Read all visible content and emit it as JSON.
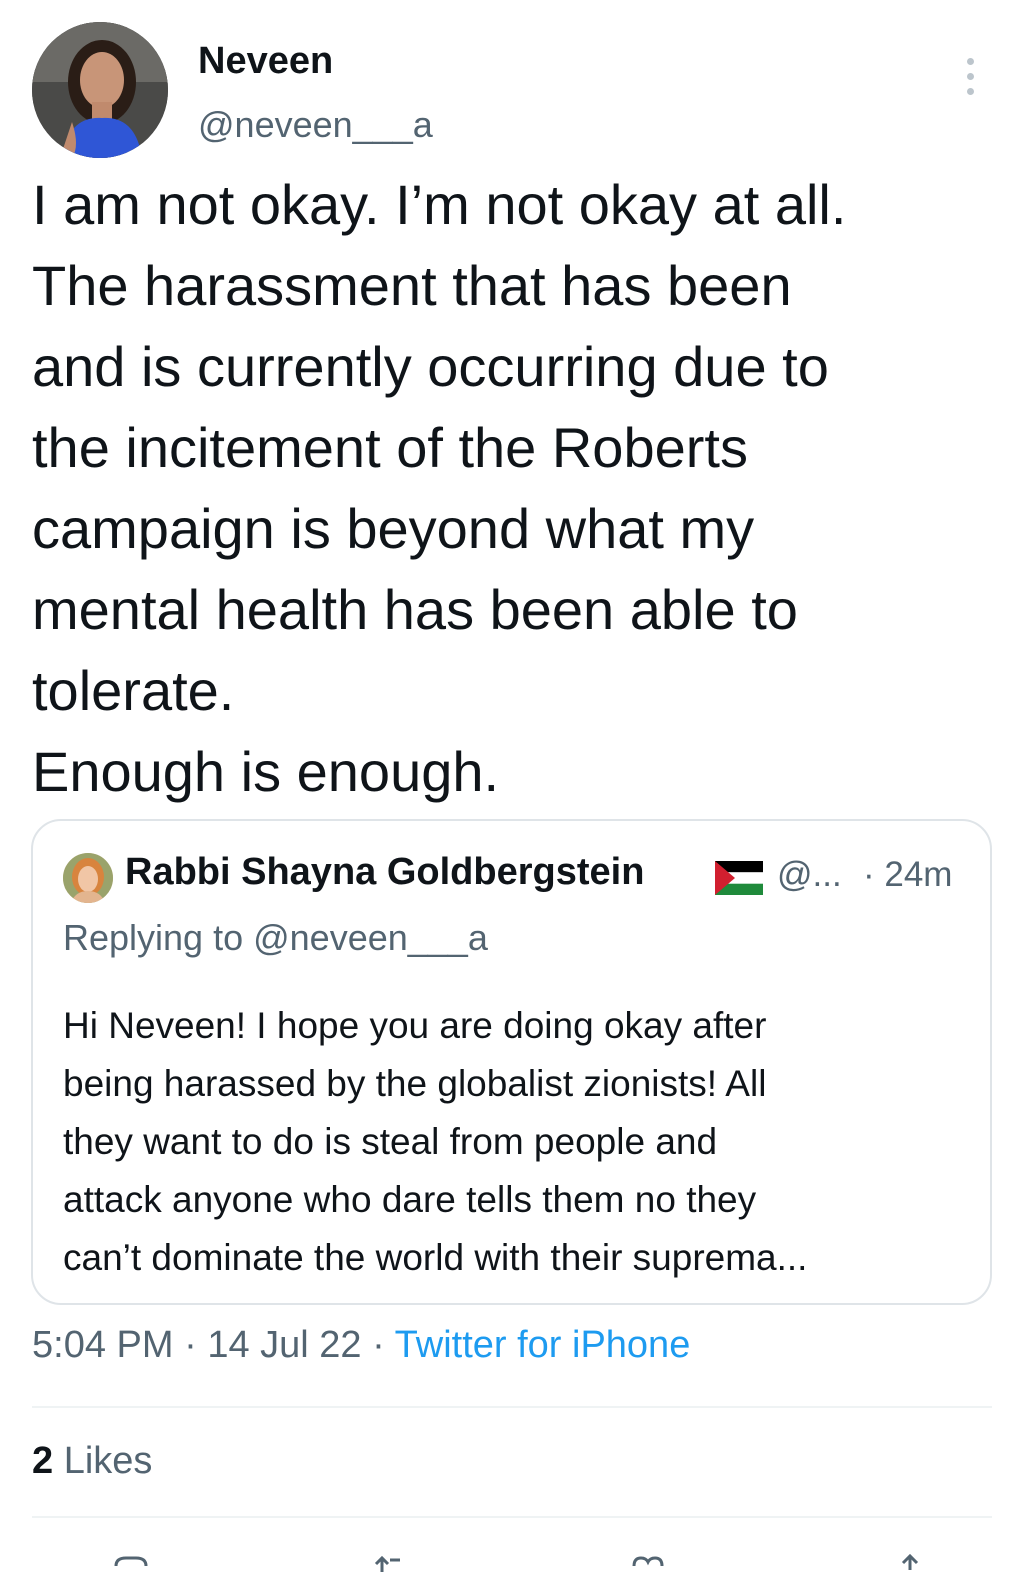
{
  "tweet": {
    "author_name": "Neveen",
    "author_handle": "@neveen___a",
    "text": "I am not okay. I’m not okay at all.\nThe harassment that has been\nand is currently occurring due to\nthe incitement of the Roberts\ncampaign is beyond what my\nmental health has been able to\ntolerate.\nEnough is enough.",
    "time": "5:04 PM",
    "date": "14 Jul 22",
    "separator": "·",
    "source": "Twitter for iPhone",
    "likes_count": "2",
    "likes_label": "Likes"
  },
  "quote": {
    "author_name": "Rabbi Shayna Goldbergstein",
    "handle": "@...",
    "time_ago": "· 24m",
    "replying_label": "Replying to @neveen___a",
    "text": "Hi Neveen! I hope you are doing okay after\nbeing harassed by the globalist zionists! All\nthey want to do is steal from people and\nattack anyone who dare tells them no they\ncan’t dominate the world with their suprema..."
  },
  "icons": [
    "more-vertical-icon",
    "palestine-flag-icon",
    "reply-icon",
    "retweet-icon",
    "like-icon",
    "share-icon"
  ],
  "colors": {
    "text_primary": "#0f1419",
    "text_secondary": "#536471",
    "link": "#1d9bf0",
    "border": "#dfe4e8"
  }
}
